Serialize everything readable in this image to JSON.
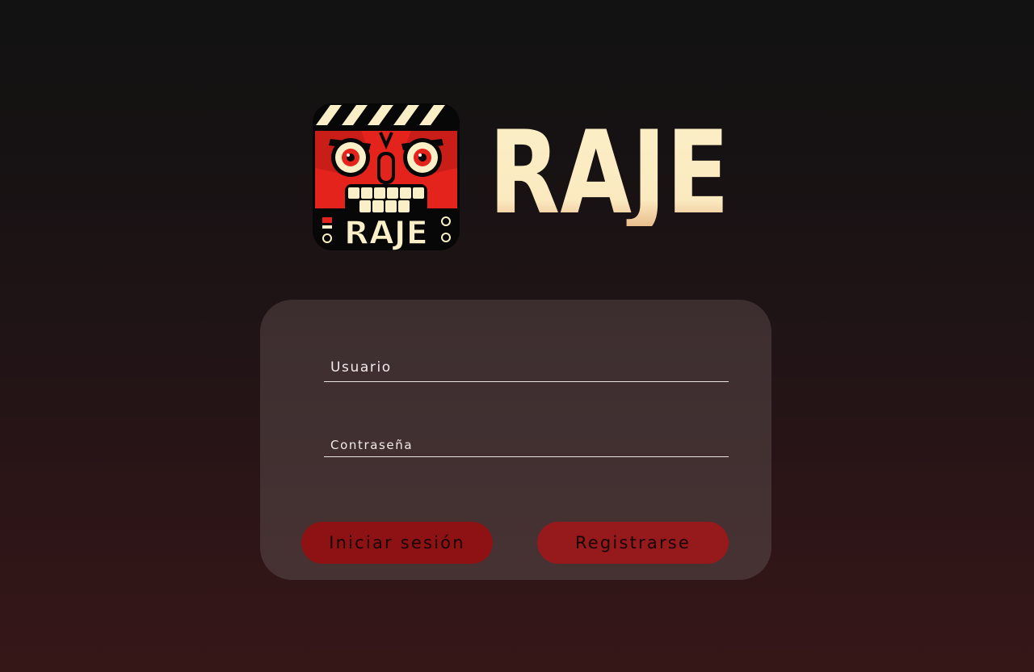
{
  "brand": {
    "app_name": "RAJE",
    "icon_text": "RAJE"
  },
  "login_form": {
    "username_placeholder": "Usuario",
    "password_placeholder": "Contraseña",
    "login_label": "Iniciar sesión",
    "register_label": "Registrarse"
  },
  "colors": {
    "background_top": "#121212",
    "background_bottom": "#361718",
    "card": "#433031",
    "accent_red": "#8e1213",
    "wordmark_cream": "#fbefc7",
    "icon_red": "#e3231c"
  }
}
